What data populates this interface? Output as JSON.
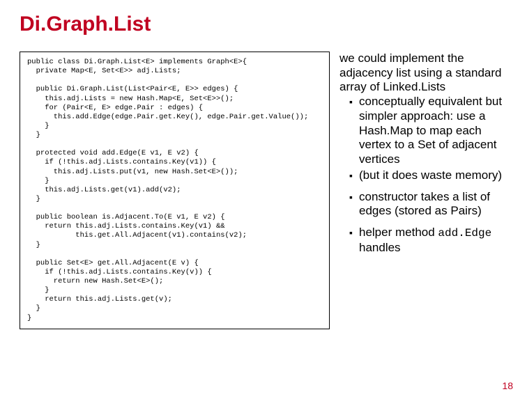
{
  "title": "Di.Graph.List",
  "code": "public class Di.Graph.List<E> implements Graph<E>{\n  private Map<E, Set<E>> adj.Lists;\n\n  public Di.Graph.List(List<Pair<E, E>> edges) {\n    this.adj.Lists = new Hash.Map<E, Set<E>>();\n    for (Pair<E, E> edge.Pair : edges) {\n      this.add.Edge(edge.Pair.get.Key(), edge.Pair.get.Value());\n    }\n  }\n\n  protected void add.Edge(E v1, E v2) {\n    if (!this.adj.Lists.contains.Key(v1)) {\n      this.adj.Lists.put(v1, new Hash.Set<E>());\n    }\n    this.adj.Lists.get(v1).add(v2);\n  }\n\n  public boolean is.Adjacent.To(E v1, E v2) {\n    return this.adj.Lists.contains.Key(v1) &&\n           this.get.All.Adjacent(v1).contains(v2);\n  }\n\n  public Set<E> get.All.Adjacent(E v) {\n    if (!this.adj.Lists.contains.Key(v)) {\n      return new Hash.Set<E>();\n    }\n    return this.adj.Lists.get(v);\n  }\n}",
  "notes": {
    "intro": "we could implement the adjacency list using a standard array of Linked.Lists",
    "bullets_a": [
      "conceptually equivalent but simpler approach: use a Hash.Map to map each vertex to a Set of adjacent vertices",
      "(but it does waste memory)"
    ],
    "bullets_b": [
      "constructor takes a list of edges (stored as Pairs)"
    ],
    "bullet_c_prefix": "helper method ",
    "bullet_c_code": "add.Edge",
    "bullet_c_suffix": " handles"
  },
  "page_number": "18"
}
